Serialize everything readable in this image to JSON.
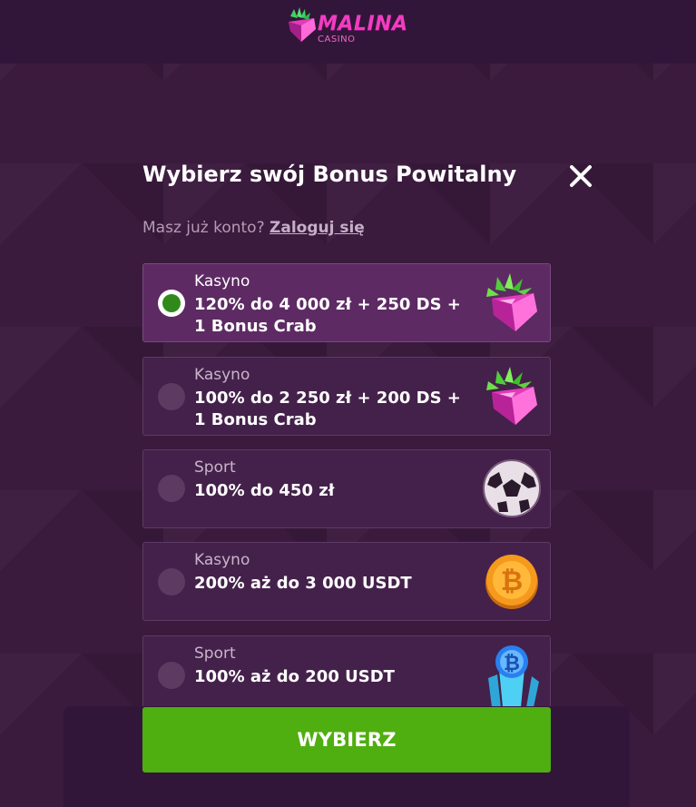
{
  "brand": {
    "name": "MALINA",
    "sub": "CASINO",
    "primary_color": "#f23cc0",
    "logo_icon": "raspberry-gem-icon"
  },
  "modal": {
    "title": "Wybierz swój Bonus Powitalny",
    "close_icon": "close-icon",
    "login_prompt": "Masz już konto?",
    "login_link": "Zaloguj się"
  },
  "options": [
    {
      "category": "Kasyno",
      "line1": "120% do 4 000 zł + 250 DS +",
      "line2": "1 Bonus Crab",
      "selected": true,
      "icon": "raspberry-gem-icon"
    },
    {
      "category": "Kasyno",
      "line1": "100% do 2 250 zł + 200 DS +",
      "line2": "1 Bonus Crab",
      "selected": false,
      "icon": "raspberry-gem-icon"
    },
    {
      "category": "Sport",
      "line1": "100% do 450 zł",
      "line2": "",
      "selected": false,
      "icon": "soccer-ball-icon"
    },
    {
      "category": "Kasyno",
      "line1": "200% aż do 3 000 USDT",
      "line2": "",
      "selected": false,
      "icon": "bitcoin-coin-icon"
    },
    {
      "category": "Sport",
      "line1": "100% aż do 200 USDT",
      "line2": "",
      "selected": false,
      "icon": "bitcoin-crystal-icon"
    }
  ],
  "submit": {
    "label": "WYBIERZ",
    "color": "#4fae10"
  }
}
